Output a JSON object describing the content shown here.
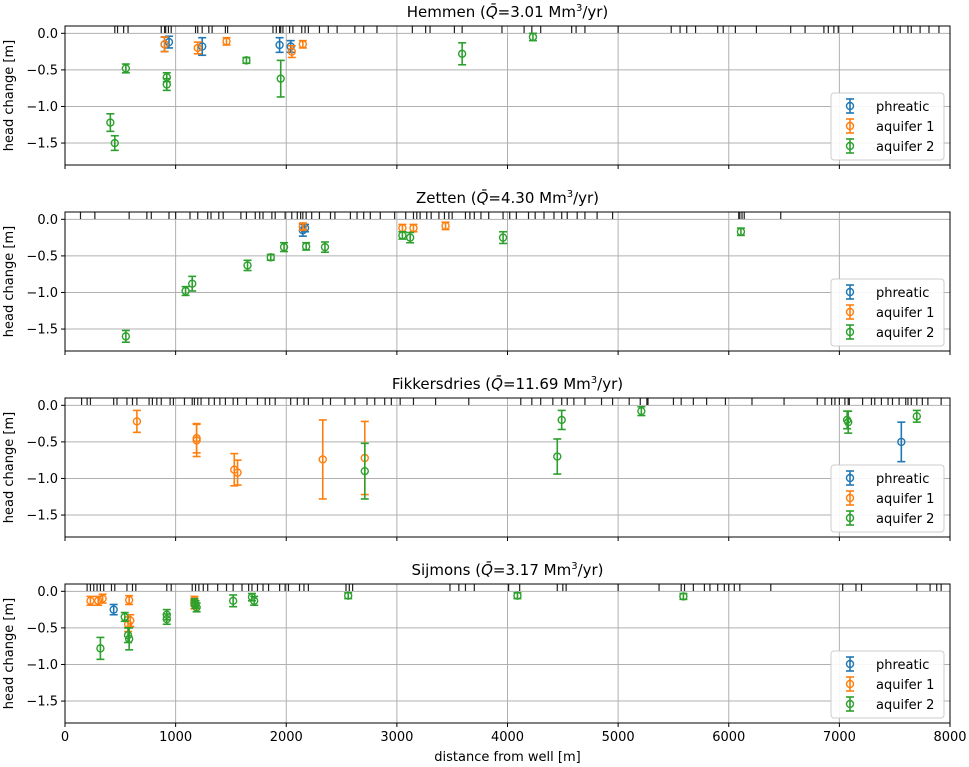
{
  "figure": {
    "xlabel": "distance from well [m]",
    "x_ticks": [
      "0",
      "1000",
      "2000",
      "3000",
      "4000",
      "5000",
      "6000",
      "7000",
      "8000"
    ],
    "colors": {
      "phreatic": "#1f77b4",
      "aquifer 1": "#ff7f0e",
      "aquifer 2": "#2ca02c",
      "grid": "#b0b0b0",
      "rug": "#222222"
    }
  },
  "chart_data": [
    {
      "type": "scatter",
      "title": "Hemmen (Q̄=3.01 Mm³/yr)",
      "title_prefix": "Hemmen (",
      "q_symbol": "Q̄",
      "q_value": "=3.01 Mm",
      "q_unit_exp": "3",
      "q_suffix": "/yr)",
      "ylabel": "head change [m]",
      "xlim": [
        0,
        8000
      ],
      "ylim": [
        -1.8,
        0.1
      ],
      "y_ticks": [
        "0.0",
        "−0.5",
        "−1.0",
        "−1.5"
      ],
      "grid": true,
      "legend_position": "lower right",
      "legend": [
        "phreatic",
        "aquifer 1",
        "aquifer 2"
      ],
      "series": [
        {
          "name": "phreatic",
          "points": [
            [
              900,
              -0.15,
              0.1
            ],
            [
              940,
              -0.12,
              0.08
            ],
            [
              1240,
              -0.18,
              0.12
            ],
            [
              1940,
              -0.16,
              0.1
            ],
            [
              2040,
              -0.18,
              0.08
            ]
          ]
        },
        {
          "name": "aquifer 1",
          "points": [
            [
              900,
              -0.15,
              0.1
            ],
            [
              1200,
              -0.2,
              0.08
            ],
            [
              1460,
              -0.11,
              0.05
            ],
            [
              2050,
              -0.25,
              0.08
            ],
            [
              2150,
              -0.15,
              0.05
            ]
          ]
        },
        {
          "name": "aquifer 2",
          "points": [
            [
              410,
              -1.22,
              0.12
            ],
            [
              450,
              -1.5,
              0.1
            ],
            [
              550,
              -0.48,
              0.06
            ],
            [
              920,
              -0.6,
              0.06
            ],
            [
              920,
              -0.7,
              0.08
            ],
            [
              1640,
              -0.37,
              0.04
            ],
            [
              1950,
              -0.62,
              0.25
            ],
            [
              3590,
              -0.28,
              0.15
            ],
            [
              4230,
              -0.05,
              0.05
            ]
          ]
        }
      ],
      "rug": [
        450,
        475,
        530,
        570,
        870,
        900,
        910,
        935,
        960,
        1180,
        1200,
        1240,
        1300,
        1330,
        1450,
        1470,
        1880,
        1910,
        1940,
        1950,
        1970,
        2030,
        2060,
        2140,
        2170,
        2200,
        2300,
        2380,
        2460,
        2620,
        2700,
        2820,
        3140,
        3260,
        3300,
        3520,
        3590,
        3950,
        4150,
        4220,
        4300,
        4580,
        4620,
        4700,
        5000,
        5480,
        5560,
        5620,
        5700,
        5900,
        5950,
        6060,
        6250,
        6560,
        6690,
        6860,
        6900,
        6950,
        6990,
        7120,
        7490,
        7550,
        7620,
        7650,
        7730,
        7810,
        7900
      ]
    },
    {
      "type": "scatter",
      "title": "Zetten (Q̄=4.30 Mm³/yr)",
      "title_prefix": "Zetten (",
      "q_symbol": "Q̄",
      "q_value": "=4.30 Mm",
      "q_unit_exp": "3",
      "q_suffix": "/yr)",
      "ylabel": "head change [m]",
      "xlim": [
        0,
        8000
      ],
      "ylim": [
        -1.8,
        0.1
      ],
      "y_ticks": [
        "0.0",
        "−0.5",
        "−1.0",
        "−1.5"
      ],
      "grid": true,
      "legend_position": "lower right",
      "legend": [
        "phreatic",
        "aquifer 1",
        "aquifer 2"
      ],
      "series": [
        {
          "name": "phreatic",
          "points": [
            [
              2150,
              -0.15,
              0.08
            ],
            [
              2170,
              -0.12,
              0.05
            ]
          ]
        },
        {
          "name": "aquifer 1",
          "points": [
            [
              2150,
              -0.1,
              0.05
            ],
            [
              3050,
              -0.12,
              0.05
            ],
            [
              3150,
              -0.12,
              0.05
            ],
            [
              3440,
              -0.09,
              0.05
            ]
          ]
        },
        {
          "name": "aquifer 2",
          "points": [
            [
              550,
              -1.6,
              0.08
            ],
            [
              1090,
              -0.98,
              0.06
            ],
            [
              1150,
              -0.88,
              0.1
            ],
            [
              1650,
              -0.63,
              0.07
            ],
            [
              1860,
              -0.52,
              0.04
            ],
            [
              1980,
              -0.38,
              0.06
            ],
            [
              2180,
              -0.37,
              0.05
            ],
            [
              2350,
              -0.38,
              0.07
            ],
            [
              3050,
              -0.22,
              0.05
            ],
            [
              3120,
              -0.25,
              0.07
            ],
            [
              3960,
              -0.25,
              0.08
            ],
            [
              6110,
              -0.17,
              0.05
            ]
          ]
        }
      ],
      "rug": [
        140,
        270,
        580,
        740,
        780,
        940,
        1000,
        1130,
        1200,
        1290,
        1320,
        1390,
        1430,
        1590,
        1640,
        1720,
        1760,
        1790,
        1870,
        1900,
        1990,
        2050,
        2100,
        2130,
        2150,
        2180,
        2230,
        2300,
        2400,
        2440,
        2580,
        2640,
        2700,
        2760,
        2850,
        2980,
        3080,
        3150,
        3180,
        3210,
        3270,
        3310,
        3380,
        3430,
        3470,
        3500,
        3620,
        3660,
        3700,
        3760,
        3830,
        3960,
        4020,
        4080,
        4190,
        4250,
        4330,
        4420,
        4490,
        4540,
        4630,
        4700,
        4810,
        4950,
        6090,
        6100,
        6120,
        6140,
        6470
      ]
    },
    {
      "type": "scatter",
      "title": "Fikkersdries (Q̄=11.69 Mm³/yr)",
      "title_prefix": "Fikkersdries (",
      "q_symbol": "Q̄",
      "q_value": "=11.69 Mm",
      "q_unit_exp": "3",
      "q_suffix": "/yr)",
      "ylabel": "head change [m]",
      "xlim": [
        0,
        8000
      ],
      "ylim": [
        -1.8,
        0.1
      ],
      "y_ticks": [
        "0.0",
        "−0.5",
        "−1.0",
        "−1.5"
      ],
      "grid": true,
      "legend_position": "lower right",
      "legend": [
        "phreatic",
        "aquifer 1",
        "aquifer 2"
      ],
      "series": [
        {
          "name": "phreatic",
          "points": [
            [
              7560,
              -0.5,
              0.27
            ]
          ]
        },
        {
          "name": "aquifer 1",
          "points": [
            [
              650,
              -0.22,
              0.15
            ],
            [
              1190,
              -0.45,
              0.2
            ],
            [
              1190,
              -0.48,
              0.22
            ],
            [
              1530,
              -0.88,
              0.22
            ],
            [
              1560,
              -0.92,
              0.17
            ],
            [
              2330,
              -0.74,
              0.54
            ],
            [
              2710,
              -0.72,
              0.5
            ]
          ]
        },
        {
          "name": "aquifer 2",
          "points": [
            [
              2710,
              -0.9,
              0.38
            ],
            [
              4450,
              -0.7,
              0.24
            ],
            [
              4490,
              -0.2,
              0.13
            ],
            [
              5210,
              -0.08,
              0.06
            ],
            [
              7070,
              -0.2,
              0.12
            ],
            [
              7080,
              -0.23,
              0.15
            ],
            [
              7700,
              -0.15,
              0.08
            ]
          ]
        }
      ],
      "rug": [
        150,
        200,
        230,
        440,
        470,
        560,
        610,
        650,
        760,
        790,
        830,
        870,
        950,
        980,
        1080,
        1150,
        1170,
        1200,
        1230,
        1300,
        1350,
        1400,
        1450,
        1520,
        1560,
        1640,
        1740,
        1810,
        1850,
        1900,
        2040,
        2100,
        2160,
        2200,
        2330,
        2400,
        2530,
        2620,
        2730,
        2800,
        2890,
        2950,
        3030,
        3150,
        3350,
        3650,
        4120,
        4220,
        4300,
        4410,
        4490,
        4540,
        4600,
        4700,
        4850,
        4950,
        5100,
        5200,
        5260,
        5270,
        5500,
        5570,
        5680,
        5800,
        5970,
        6210,
        6500,
        6800,
        6870,
        6930,
        6960,
        7000,
        7050,
        7080,
        7090,
        7210,
        7290,
        7320,
        7380,
        7440,
        7480,
        7540,
        7600,
        7620,
        7650,
        7700,
        7750,
        7800,
        7920
      ]
    },
    {
      "type": "scatter",
      "title": "Sijmons (Q̄=3.17 Mm³/yr)",
      "title_prefix": "Sijmons (",
      "q_symbol": "Q̄",
      "q_value": "=3.17 Mm",
      "q_unit_exp": "3",
      "q_suffix": "/yr)",
      "ylabel": "head change [m]",
      "xlim": [
        0,
        8000
      ],
      "ylim": [
        -1.8,
        0.1
      ],
      "y_ticks": [
        "0.0",
        "−0.5",
        "−1.0",
        "−1.5"
      ],
      "grid": true,
      "legend_position": "lower right",
      "legend": [
        "phreatic",
        "aquifer 1",
        "aquifer 2"
      ],
      "series": [
        {
          "name": "phreatic",
          "points": [
            [
              440,
              -0.25,
              0.07
            ]
          ]
        },
        {
          "name": "aquifer 1",
          "points": [
            [
              230,
              -0.13,
              0.06
            ],
            [
              300,
              -0.13,
              0.06
            ],
            [
              340,
              -0.1,
              0.06
            ],
            [
              580,
              -0.12,
              0.06
            ],
            [
              590,
              -0.4,
              0.08
            ],
            [
              570,
              -0.45,
              0.1
            ],
            [
              1170,
              -0.18,
              0.06
            ],
            [
              1170,
              -0.12,
              0.05
            ]
          ]
        },
        {
          "name": "aquifer 2",
          "points": [
            [
              320,
              -0.78,
              0.15
            ],
            [
              540,
              -0.35,
              0.06
            ],
            [
              570,
              -0.6,
              0.1
            ],
            [
              580,
              -0.65,
              0.15
            ],
            [
              920,
              -0.32,
              0.07
            ],
            [
              920,
              -0.38,
              0.07
            ],
            [
              1170,
              -0.15,
              0.05
            ],
            [
              1180,
              -0.18,
              0.05
            ],
            [
              1190,
              -0.22,
              0.06
            ],
            [
              1520,
              -0.13,
              0.08
            ],
            [
              1690,
              -0.08,
              0.05
            ],
            [
              1710,
              -0.13,
              0.06
            ],
            [
              2560,
              -0.06,
              0.04
            ],
            [
              4090,
              -0.06,
              0.04
            ],
            [
              5590,
              -0.07,
              0.04
            ]
          ]
        }
      ],
      "rug": [
        200,
        230,
        260,
        290,
        320,
        350,
        420,
        450,
        560,
        610,
        640,
        920,
        960,
        1150,
        1180,
        1210,
        1250,
        1290,
        1380,
        1460,
        1520,
        1600,
        1660,
        1690,
        1740,
        1790,
        1840,
        1940,
        1990,
        2020,
        2120,
        2160,
        2200,
        2540,
        2570,
        2600,
        3480,
        3560,
        3620,
        3700,
        4010,
        4110,
        4450,
        4500,
        4530,
        5000,
        5370,
        5570,
        5600,
        5680,
        5780,
        5830,
        5900,
        5960,
        6000,
        6050,
        6100,
        6380,
        7030,
        7150,
        7200,
        7700,
        7820,
        7880,
        7920
      ]
    }
  ]
}
